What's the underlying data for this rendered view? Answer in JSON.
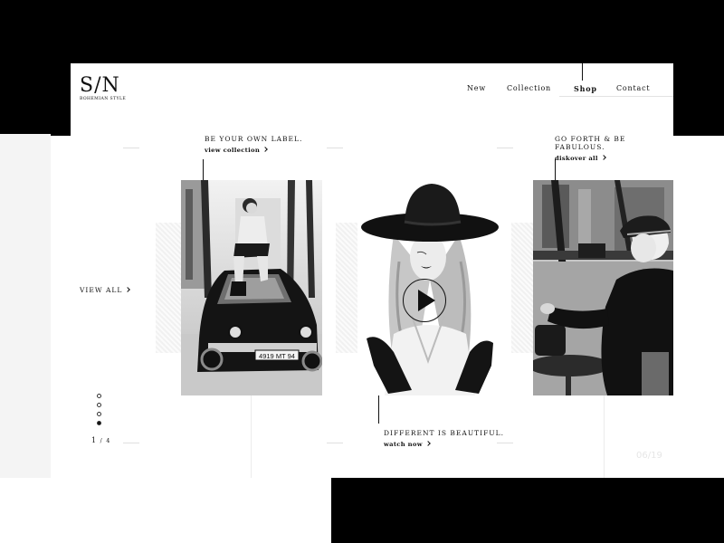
{
  "brand": {
    "mark": "S/N",
    "tagline": "BOHEMIAN STYLE"
  },
  "nav": {
    "new": "New",
    "collection": "Collection",
    "shop": "Shop",
    "contact": "Contact"
  },
  "captions": {
    "left": {
      "title": "BE YOUR OWN LABEL.",
      "link": "view collection"
    },
    "center": {
      "title": "DIFFERENT IS BEAUTIFUL.",
      "link": "watch now"
    },
    "right": {
      "title": "GO FORTH & BE FABULOUS.",
      "link": "diskover all"
    }
  },
  "car_plate": "4919 MT 94",
  "view_all": "VIEW ALL",
  "pager": {
    "current": "1",
    "total": "4"
  },
  "slides": {
    "active_index": 4,
    "count": 4
  },
  "counter": "06/19",
  "colors": {
    "ink": "#111111",
    "paper": "#ffffff",
    "backdrop": "#000000"
  }
}
